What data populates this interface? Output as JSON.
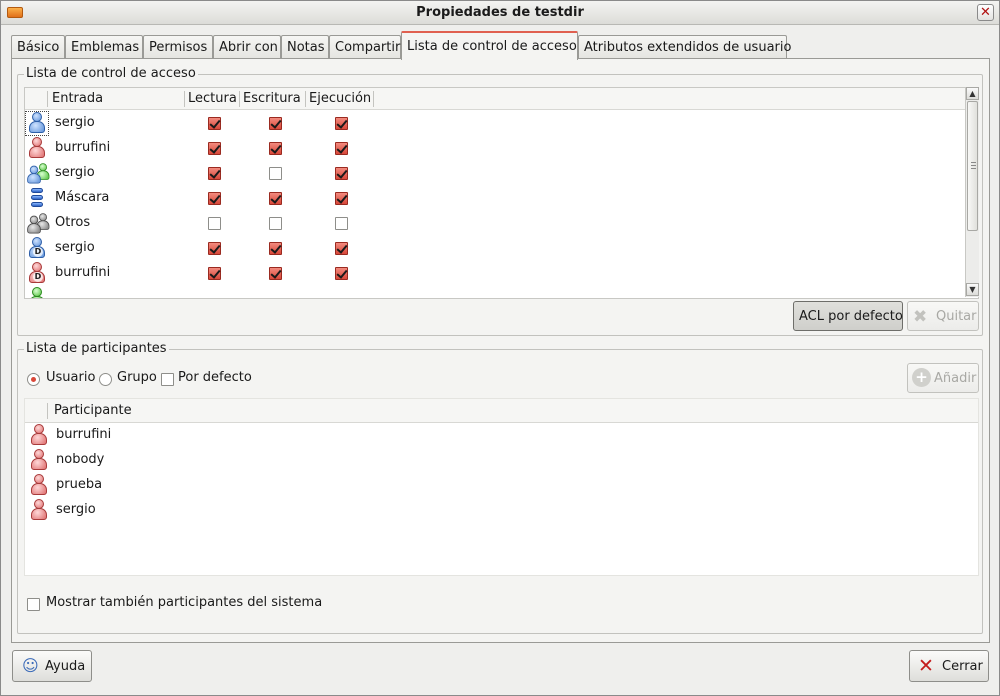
{
  "window": {
    "title": "Propiedades de testdir"
  },
  "tabs": [
    {
      "label": "Básico"
    },
    {
      "label": "Emblemas"
    },
    {
      "label": "Permisos"
    },
    {
      "label": "Abrir con"
    },
    {
      "label": "Notas"
    },
    {
      "label": "Compartir"
    },
    {
      "label": "Lista de control de acceso"
    },
    {
      "label": "Atributos extendidos de usuario"
    }
  ],
  "acl": {
    "frame_label": "Lista de control de acceso",
    "columns": {
      "entry": "Entrada",
      "read": "Lectura",
      "write": "Escritura",
      "exec": "Ejecución"
    },
    "rows": [
      {
        "icon": "user-blue-icon",
        "name": "sergio",
        "read": true,
        "write": true,
        "exec": true
      },
      {
        "icon": "user-red-icon",
        "name": "burrufini",
        "read": true,
        "write": true,
        "exec": true
      },
      {
        "icon": "group-blue-green-icon",
        "name": "sergio",
        "read": true,
        "write": false,
        "exec": true
      },
      {
        "icon": "mask-icon",
        "name": "Máscara",
        "read": true,
        "write": true,
        "exec": true
      },
      {
        "icon": "others-icon",
        "name": "Otros",
        "read": false,
        "write": false,
        "exec": false
      },
      {
        "icon": "default-user-blue-icon",
        "name": "sergio",
        "read": true,
        "write": true,
        "exec": true
      },
      {
        "icon": "default-user-red-icon",
        "name": "burrufini",
        "read": true,
        "write": true,
        "exec": true
      }
    ],
    "buttons": {
      "default_acl": "ACL por defecto",
      "remove": "Quitar"
    }
  },
  "participants": {
    "frame_label": "Lista de participantes",
    "options": {
      "user": "Usuario",
      "group": "Grupo",
      "default": "Por defecto"
    },
    "add_button": "Añadir",
    "column": "Participante",
    "items": [
      "burrufini",
      "nobody",
      "prueba",
      "sergio"
    ],
    "show_system": "Mostrar también participantes del sistema"
  },
  "footer": {
    "help": "Ayuda",
    "close": "Cerrar"
  }
}
